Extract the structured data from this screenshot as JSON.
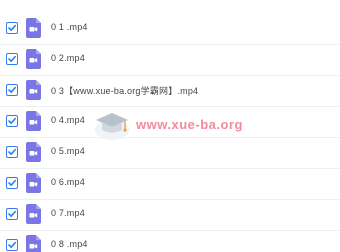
{
  "files": [
    {
      "name": "0 1 .mp4",
      "checked": true
    },
    {
      "name": "0 2.mp4",
      "checked": true
    },
    {
      "name": "0 3【www.xue-ba.org学霸网】.mp4",
      "checked": true
    },
    {
      "name": "0 4.mp4",
      "checked": true
    },
    {
      "name": "0 5.mp4",
      "checked": true
    },
    {
      "name": "0 6.mp4",
      "checked": true
    },
    {
      "name": "0 7.mp4",
      "checked": true
    },
    {
      "name": "0 8 .mp4",
      "checked": true
    }
  ],
  "watermark": {
    "text": "www.xue-ba.org"
  },
  "colors": {
    "checkbox_accent": "#2f80ed",
    "video_icon": "#7b76e6",
    "folder_icon": "#f6c343",
    "watermark_text": "#f08c9c"
  }
}
